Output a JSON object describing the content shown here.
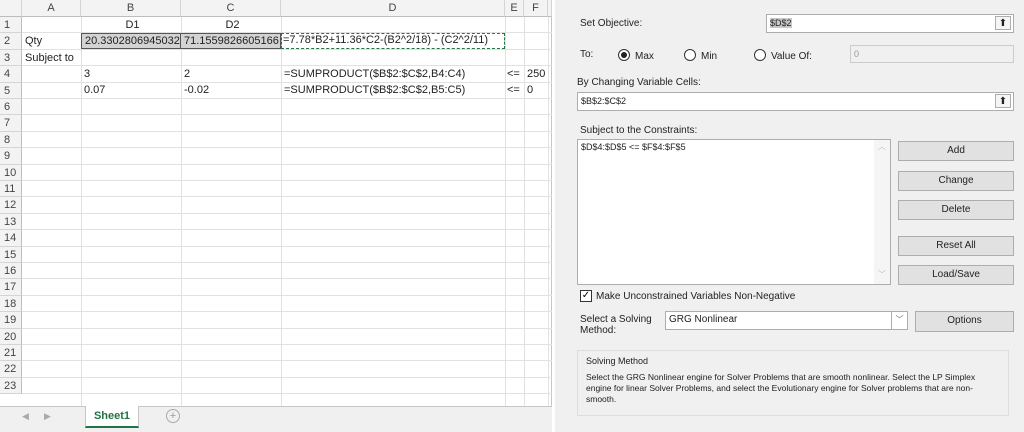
{
  "sheet": {
    "columns": [
      "A",
      "B",
      "C",
      "D",
      "E",
      "F"
    ],
    "rows": [
      "1",
      "2",
      "3",
      "4",
      "5",
      "6",
      "7",
      "8",
      "9",
      "10",
      "11",
      "12",
      "13",
      "14",
      "15",
      "16",
      "17",
      "18",
      "19",
      "20",
      "21",
      "22",
      "23"
    ],
    "cells": {
      "B1": "D1",
      "C1": "D2",
      "A2": "Qty",
      "B2": "20.3302806945032",
      "C2": "71.1559826605166",
      "D2": "=7.78*B2+11.36*C2-(B2^2/18) - (C2^2/11)",
      "A3": "Subject to",
      "B4": "3",
      "C4": "2",
      "D4": "=SUMPRODUCT($B$2:$C$2,B4:C4)",
      "E4": "<=",
      "F4": "250",
      "B5": "0.07",
      "C5": "-0.02",
      "D5": "=SUMPRODUCT($B$2:$C$2,B5:C5)",
      "E5": "<=",
      "F5": "0"
    },
    "tab": "Sheet1"
  },
  "solver": {
    "set_objective_label": "Set Objective:",
    "objective_value": "$D$2",
    "to_label": "To:",
    "max_label": "Max",
    "min_label": "Min",
    "value_of_label": "Value Of:",
    "value_of_value": "0",
    "selected": "Max",
    "changing_label": "By Changing Variable Cells:",
    "changing_value": "$B$2:$C$2",
    "constraints_label": "Subject to the Constraints:",
    "constraints": [
      "$D$4:$D$5 <= $F$4:$F$5"
    ],
    "buttons": {
      "add": "Add",
      "change": "Change",
      "delete": "Delete",
      "reset": "Reset All",
      "load": "Load/Save",
      "options": "Options"
    },
    "nonneg_label": "Make Unconstrained Variables Non-Negative",
    "nonneg_checked": true,
    "method_label": "Select a Solving Method:",
    "method_value": "GRG Nonlinear",
    "group_title": "Solving Method",
    "group_text": "Select the GRG Nonlinear engine for Solver Problems that are smooth nonlinear. Select the LP Simplex engine for linear Solver Problems, and select the Evolutionary engine for Solver problems that are non-smooth."
  }
}
